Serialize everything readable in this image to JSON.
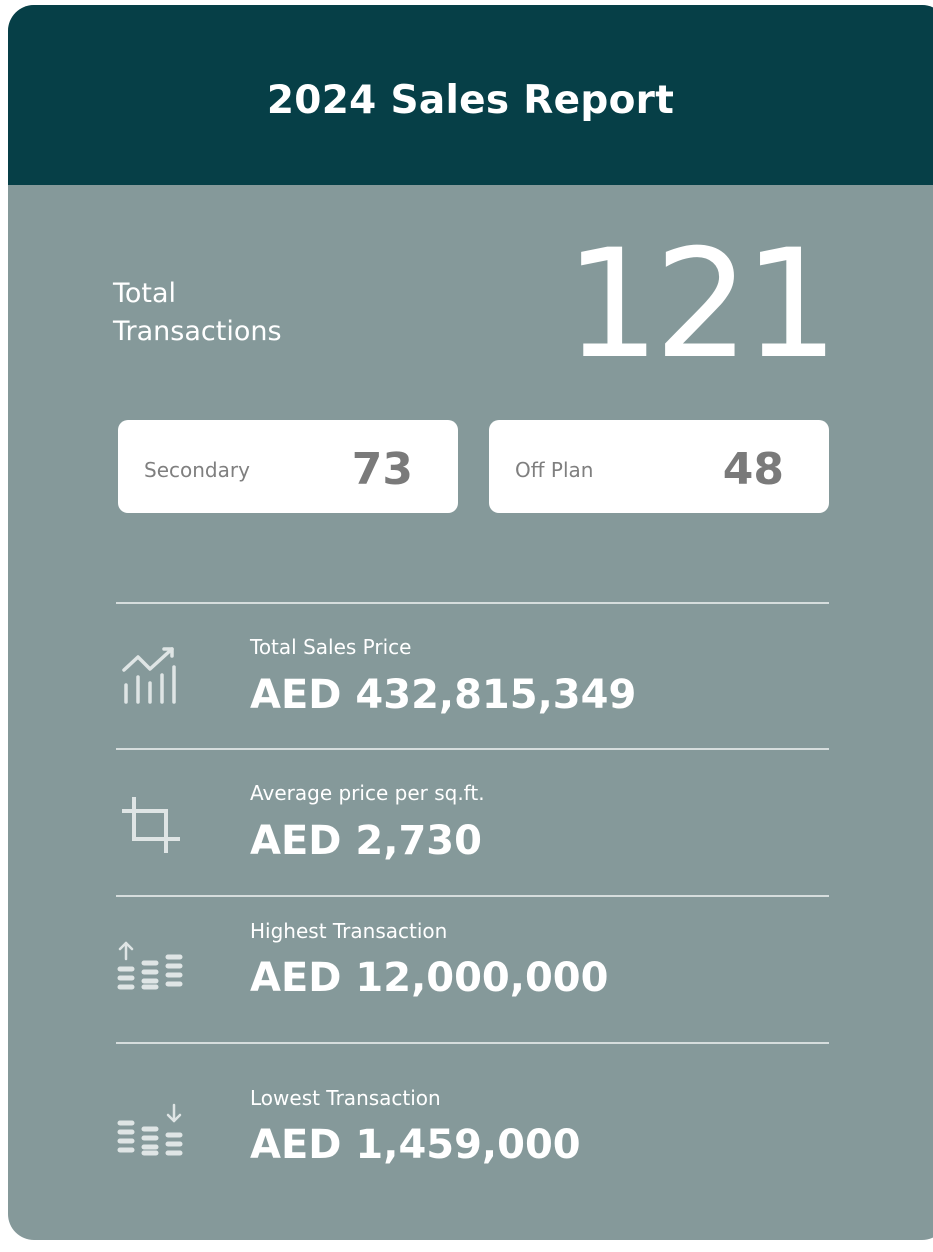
{
  "header": {
    "title": "2024 Sales Report"
  },
  "total": {
    "label_line1": "Total",
    "label_line2": "Transactions",
    "value": "121"
  },
  "breakdown": [
    {
      "label": "Secondary",
      "value": "73"
    },
    {
      "label": "Off Plan",
      "value": "48"
    }
  ],
  "metrics": [
    {
      "icon": "line-bar-chart-icon",
      "label": "Total Sales Price",
      "value": "AED 432,815,349"
    },
    {
      "icon": "crop-icon",
      "label": "Average price per sq.ft.",
      "value": "AED 2,730"
    },
    {
      "icon": "coins-up-icon",
      "label": "Highest Transaction",
      "value": "AED 12,000,000"
    },
    {
      "icon": "coins-down-icon",
      "label": "Lowest Transaction",
      "value": "AED 1,459,000"
    }
  ],
  "colors": {
    "header_bg": "#063f47",
    "card_bg": "#85999a",
    "pill_bg": "#ffffff",
    "text_light": "#ffffff",
    "pill_text": "#7a7a7a",
    "icon_color": "#dfe5e5"
  }
}
